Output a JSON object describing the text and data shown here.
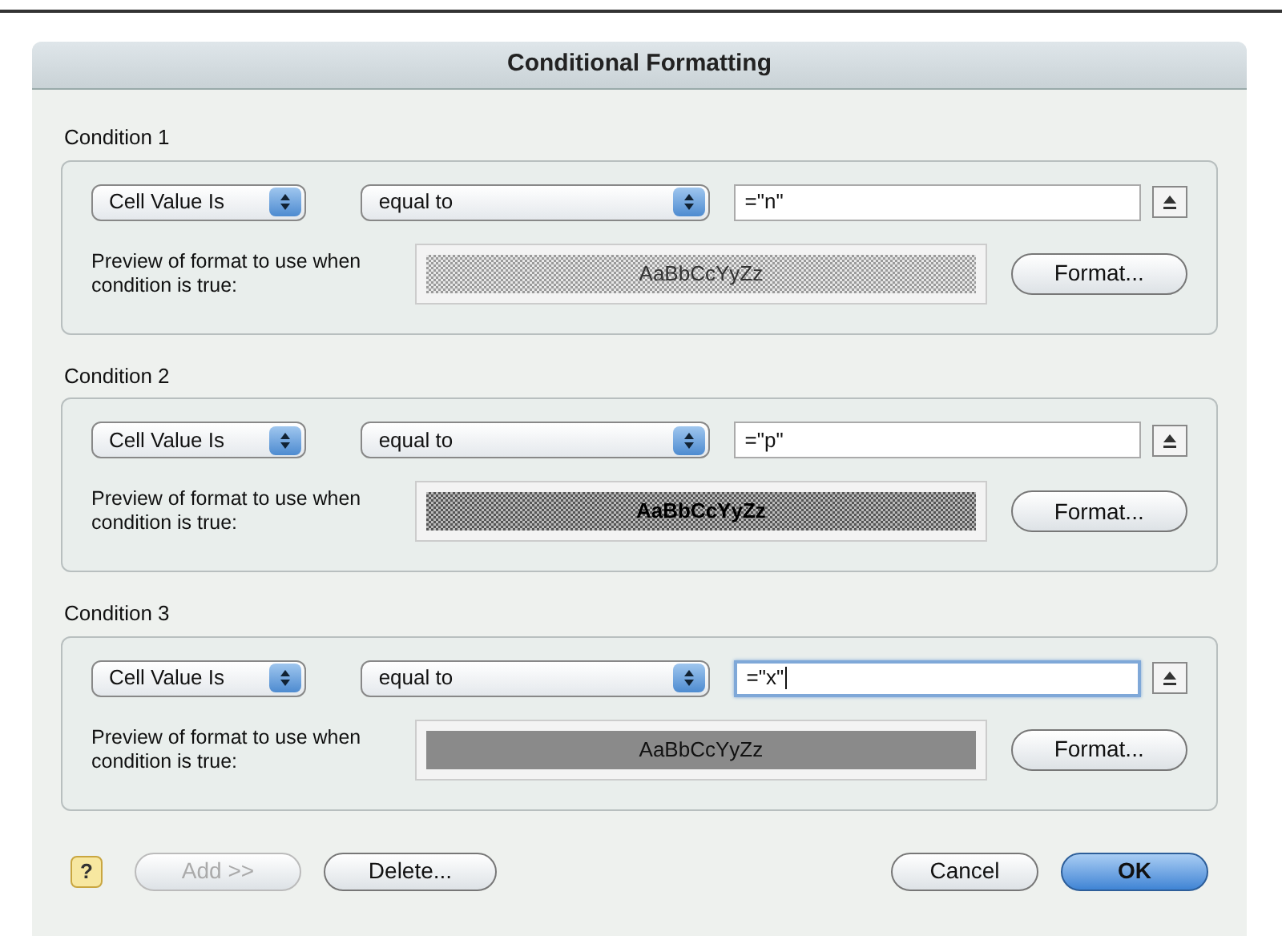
{
  "window": {
    "title": "Conditional Formatting"
  },
  "conditions": [
    {
      "label": "Condition 1",
      "type": "Cell Value Is",
      "operator": "equal to",
      "value": "=\"n\"",
      "focused": false,
      "preview_label": "Preview of format to use when condition is true:",
      "preview_text": "AaBbCcYyZz",
      "kind": "light-pattern",
      "format_button": "Format..."
    },
    {
      "label": "Condition 2",
      "type": "Cell Value Is",
      "operator": "equal to",
      "value": "=\"p\"",
      "focused": false,
      "preview_label": "Preview of format to use when condition is true:",
      "preview_text": "AaBbCcYyZz",
      "kind": "dark-pattern",
      "format_button": "Format..."
    },
    {
      "label": "Condition 3",
      "type": "Cell Value Is",
      "operator": "equal to",
      "value": "=\"x\"",
      "focused": true,
      "preview_label": "Preview of format to use when condition is true:",
      "preview_text": "AaBbCcYyZz",
      "kind": "solid",
      "format_button": "Format..."
    }
  ],
  "help_button": "?",
  "buttons": [
    {
      "label": "Add >>",
      "kind": "plain",
      "disabled": true
    },
    {
      "label": "Delete...",
      "kind": "plain",
      "disabled": false
    },
    {
      "label": "Cancel",
      "kind": "plain",
      "disabled": false
    },
    {
      "label": "OK",
      "kind": "default",
      "disabled": false
    }
  ]
}
